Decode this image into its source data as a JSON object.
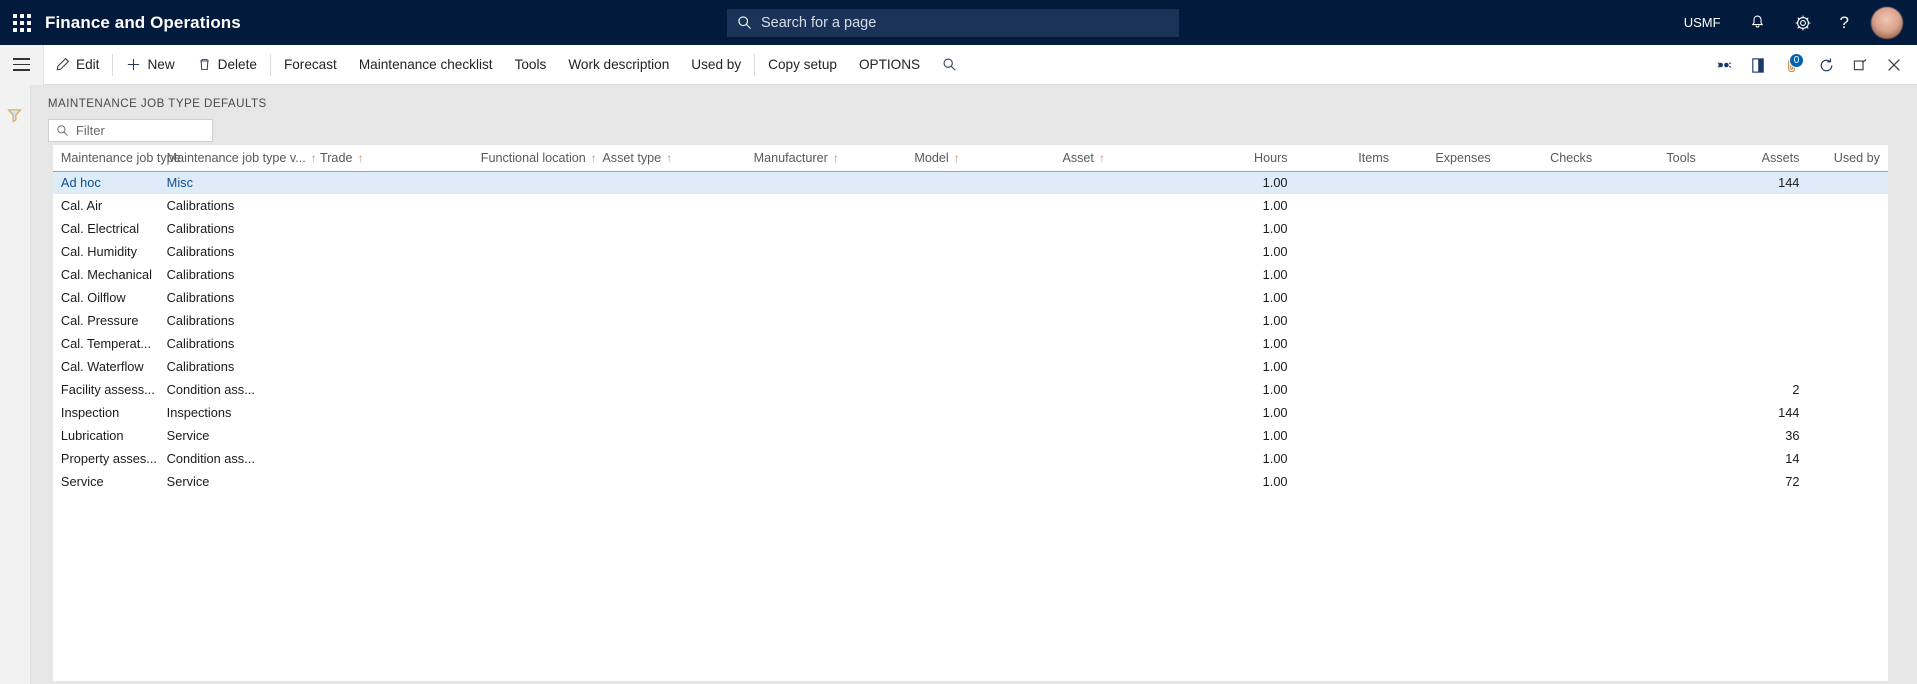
{
  "topbar": {
    "waffle_icon": "app-launcher-icon",
    "app_title": "Finance and Operations",
    "search": {
      "placeholder": "Search for a page",
      "value": "",
      "icon": "search-icon"
    },
    "company": "USMF",
    "notifications_icon": "bell-icon",
    "settings_icon": "gear-icon",
    "help_icon": "question-mark-icon",
    "avatar": "user-avatar"
  },
  "toolbar": {
    "hamburger_icon": "hamburger-menu-icon",
    "buttons": [
      {
        "label": "Edit",
        "icon": "pencil-icon"
      },
      {
        "label": "New",
        "icon": "plus-icon"
      },
      {
        "label": "Delete",
        "icon": "trash-icon"
      },
      {
        "label": "Forecast",
        "icon": ""
      },
      {
        "label": "Maintenance checklist",
        "icon": ""
      },
      {
        "label": "Tools",
        "icon": ""
      },
      {
        "label": "Work description",
        "icon": ""
      },
      {
        "label": "Used by",
        "icon": ""
      },
      {
        "label": "Copy setup",
        "icon": ""
      },
      {
        "label": "OPTIONS",
        "icon": ""
      }
    ],
    "search_icon": "search-icon",
    "right_icons": [
      {
        "name": "share-icon"
      },
      {
        "name": "open-in-new-icon"
      },
      {
        "name": "attachment-icon",
        "badge": "0"
      },
      {
        "name": "refresh-icon"
      },
      {
        "name": "popout-icon"
      },
      {
        "name": "close-icon"
      }
    ]
  },
  "navpane": {
    "filter_icon": "filter-funnel-icon"
  },
  "page": {
    "title": "MAINTENANCE JOB TYPE DEFAULTS",
    "filter": {
      "placeholder": "Filter",
      "value": "",
      "icon": "search-icon"
    }
  },
  "grid": {
    "columns": [
      {
        "label": "Maintenance job type",
        "sorted": false,
        "align": "left"
      },
      {
        "label": "Maintenance job type v...",
        "sorted": true,
        "align": "left"
      },
      {
        "label": "Trade",
        "sorted": true,
        "align": "left"
      },
      {
        "label": "Functional location",
        "sorted": true,
        "align": "left"
      },
      {
        "label": "Asset type",
        "sorted": true,
        "align": "left"
      },
      {
        "label": "Manufacturer",
        "sorted": true,
        "align": "left"
      },
      {
        "label": "Model",
        "sorted": true,
        "align": "left"
      },
      {
        "label": "Asset",
        "sorted": true,
        "align": "left"
      },
      {
        "label": "Hours",
        "sorted": false,
        "align": "right"
      },
      {
        "label": "Items",
        "sorted": false,
        "align": "right"
      },
      {
        "label": "Expenses",
        "sorted": false,
        "align": "right"
      },
      {
        "label": "Checks",
        "sorted": false,
        "align": "right"
      },
      {
        "label": "Tools",
        "sorted": false,
        "align": "right"
      },
      {
        "label": "Assets",
        "sorted": false,
        "align": "right"
      },
      {
        "label": "Used by",
        "sorted": false,
        "align": "right"
      }
    ],
    "rows": [
      {
        "selected": true,
        "cells": [
          "Ad hoc",
          "Misc",
          "",
          "",
          "",
          "",
          "",
          "",
          "1.00",
          "",
          "",
          "",
          "",
          "144",
          ""
        ]
      },
      {
        "selected": false,
        "cells": [
          "Cal. Air",
          "Calibrations",
          "",
          "",
          "",
          "",
          "",
          "",
          "1.00",
          "",
          "",
          "",
          "",
          "",
          ""
        ]
      },
      {
        "selected": false,
        "cells": [
          "Cal. Electrical",
          "Calibrations",
          "",
          "",
          "",
          "",
          "",
          "",
          "1.00",
          "",
          "",
          "",
          "",
          "",
          ""
        ]
      },
      {
        "selected": false,
        "cells": [
          "Cal. Humidity",
          "Calibrations",
          "",
          "",
          "",
          "",
          "",
          "",
          "1.00",
          "",
          "",
          "",
          "",
          "",
          ""
        ]
      },
      {
        "selected": false,
        "cells": [
          "Cal. Mechanical",
          "Calibrations",
          "",
          "",
          "",
          "",
          "",
          "",
          "1.00",
          "",
          "",
          "",
          "",
          "",
          ""
        ]
      },
      {
        "selected": false,
        "cells": [
          "Cal. Oilflow",
          "Calibrations",
          "",
          "",
          "",
          "",
          "",
          "",
          "1.00",
          "",
          "",
          "",
          "",
          "",
          ""
        ]
      },
      {
        "selected": false,
        "cells": [
          "Cal. Pressure",
          "Calibrations",
          "",
          "",
          "",
          "",
          "",
          "",
          "1.00",
          "",
          "",
          "",
          "",
          "",
          ""
        ]
      },
      {
        "selected": false,
        "cells": [
          "Cal. Temperat...",
          "Calibrations",
          "",
          "",
          "",
          "",
          "",
          "",
          "1.00",
          "",
          "",
          "",
          "",
          "",
          ""
        ]
      },
      {
        "selected": false,
        "cells": [
          "Cal. Waterflow",
          "Calibrations",
          "",
          "",
          "",
          "",
          "",
          "",
          "1.00",
          "",
          "",
          "",
          "",
          "",
          ""
        ]
      },
      {
        "selected": false,
        "cells": [
          "Facility assess...",
          "Condition ass...",
          "",
          "",
          "",
          "",
          "",
          "",
          "1.00",
          "",
          "",
          "",
          "",
          "2",
          ""
        ]
      },
      {
        "selected": false,
        "cells": [
          "Inspection",
          "Inspections",
          "",
          "",
          "",
          "",
          "",
          "",
          "1.00",
          "",
          "",
          "",
          "",
          "144",
          ""
        ]
      },
      {
        "selected": false,
        "cells": [
          "Lubrication",
          "Service",
          "",
          "",
          "",
          "",
          "",
          "",
          "1.00",
          "",
          "",
          "",
          "",
          "36",
          ""
        ]
      },
      {
        "selected": false,
        "cells": [
          "Property asses...",
          "Condition ass...",
          "",
          "",
          "",
          "",
          "",
          "",
          "1.00",
          "",
          "",
          "",
          "",
          "14",
          ""
        ]
      },
      {
        "selected": false,
        "cells": [
          "Service",
          "Service",
          "",
          "",
          "",
          "",
          "",
          "",
          "1.00",
          "",
          "",
          "",
          "",
          "72",
          ""
        ]
      }
    ]
  },
  "colors": {
    "nav_bg": "#021A3C",
    "search_bg": "#1B3358",
    "selection_bg": "#deecf9",
    "selection_text": "#0b4d8f",
    "badge_bg": "#0063B1",
    "sort_arrow": "#c98a68",
    "page_bg": "#e6e6e6"
  }
}
